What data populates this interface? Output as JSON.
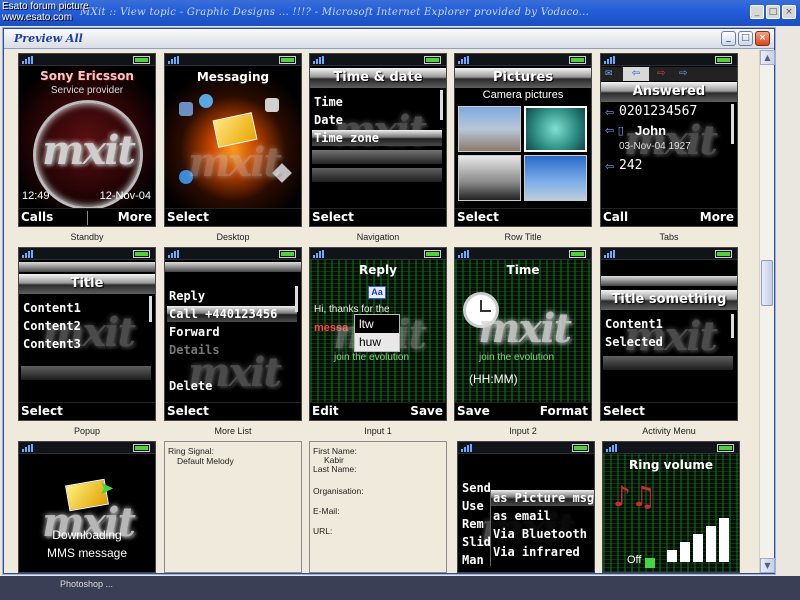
{
  "watermark": {
    "line1": "Esato forum picture",
    "line2": "www.esato.com"
  },
  "browser": {
    "title": "MXit :: View topic - Graphic Designs ... !!!? - Microsoft Internet Explorer provided by Vodaco..."
  },
  "dialog": {
    "title": "Preview All"
  },
  "taskbar": {
    "item": "Photoshop ..."
  },
  "cells": {
    "standby": {
      "caption": "Standby",
      "brand": "Sony Ericsson",
      "provider": "Service provider",
      "time": "12:49",
      "date": "12-Nov-04",
      "soft_left": "Calls",
      "soft_right": "More",
      "logo": "mxit"
    },
    "desktop": {
      "caption": "Desktop",
      "title": "Messaging",
      "soft_left": "Select",
      "logo": "mxit"
    },
    "navigation": {
      "caption": "Navigation",
      "title": "Time & date",
      "items": [
        "Time",
        "Date",
        "Time zone"
      ],
      "soft_left": "Select",
      "logo": "mxit"
    },
    "row_title": {
      "caption": "Row Title",
      "title": "Pictures",
      "subtitle": "Camera pictures",
      "soft_left": "Select"
    },
    "tabs": {
      "caption": "Tabs",
      "title": "Answered",
      "number": "0201234567",
      "name": "John",
      "datetime": "03-Nov-04 1927",
      "extra": "242",
      "soft_left": "Call",
      "soft_right": "More",
      "logo": "mxit"
    },
    "popup": {
      "caption": "Popup",
      "title": "Title",
      "items": [
        "Content1",
        "Content2",
        "Content3"
      ],
      "soft_left": "Select",
      "logo": "mxit"
    },
    "more_list": {
      "caption": "More List",
      "items": [
        "Reply",
        "Call +440123456",
        "Forward",
        "Details",
        "Delete"
      ],
      "soft_left": "Select",
      "logo": "mxit"
    },
    "input1": {
      "caption": "Input 1",
      "title": "Reply",
      "mode": "Aa",
      "text1": "Hi, thanks for the",
      "text2": "messa",
      "text3": "join the evolution",
      "options": [
        "ltw",
        "huw"
      ],
      "soft_left": "Edit",
      "soft_right": "Save",
      "logo": "mxit"
    },
    "input2": {
      "caption": "Input 2",
      "title": "Time",
      "tagline": "join the evolution",
      "format": "(HH:MM)",
      "soft_left": "Save",
      "soft_right": "Format",
      "logo": "mxit"
    },
    "activity_menu": {
      "caption": "Activity Menu",
      "title": "Title something",
      "items": [
        "Content1",
        "Selected"
      ],
      "soft_left": "Select",
      "logo": "mxit"
    },
    "download": {
      "line1": "Downloading",
      "line2": "MMS message",
      "logo": "mxit"
    },
    "ring_info": {
      "label": "Ring Signal:",
      "value": "Default Melody"
    },
    "contact_form": {
      "fields": [
        "First Name:",
        "Kabir",
        "Last Name:",
        "Organisation:",
        "E-Mail:",
        "URL:"
      ]
    },
    "send_menu": {
      "bg_items": [
        "Send",
        "Use",
        "Rem",
        "Slid",
        "Man"
      ],
      "options": [
        "as Picture msg",
        "as email",
        "Via Bluetooth",
        "Via infrared"
      ],
      "logo": "mxit"
    },
    "ring_volume": {
      "title": "Ring volume",
      "label": "Off"
    }
  }
}
